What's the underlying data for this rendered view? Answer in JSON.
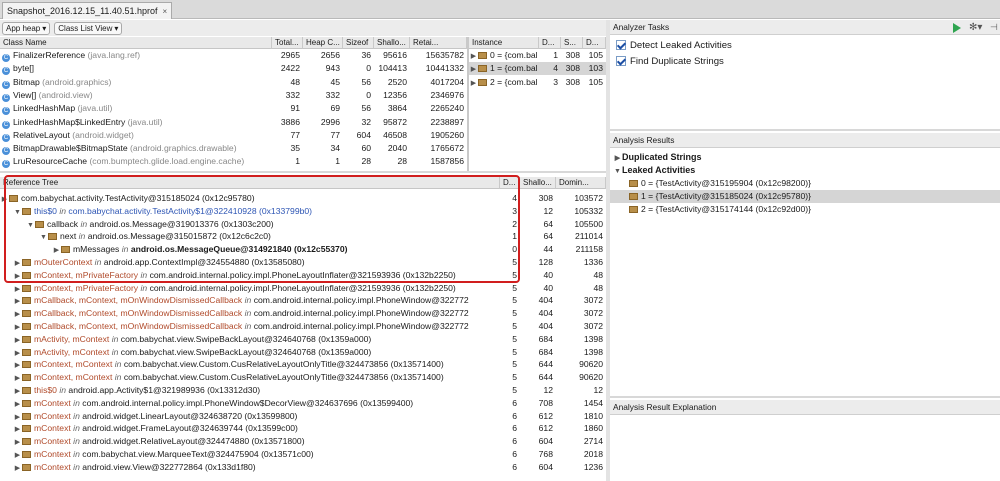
{
  "tab": {
    "title": "Snapshot_2016.12.15_11.40.51.hprof",
    "close": "×"
  },
  "toolbar": {
    "heap": "App heap",
    "view": "Class List View"
  },
  "class_table": {
    "headers": [
      "Class Name",
      "Total...",
      "Heap C...",
      "Sizeof",
      "Shallo...",
      "Retai..."
    ],
    "rows": [
      {
        "name": "FinalizerReference",
        "pkg": "(java.lang.ref)",
        "total": "2965",
        "heap": "2656",
        "sizeof": "36",
        "shallow": "95616",
        "retained": "15635782"
      },
      {
        "name": "byte[]",
        "pkg": "",
        "total": "2422",
        "heap": "943",
        "sizeof": "0",
        "shallow": "104413",
        "retained": "10441332"
      },
      {
        "name": "Bitmap",
        "pkg": "(android.graphics)",
        "total": "48",
        "heap": "45",
        "sizeof": "56",
        "shallow": "2520",
        "retained": "4017204"
      },
      {
        "name": "View[]",
        "pkg": "(android.view)",
        "total": "332",
        "heap": "332",
        "sizeof": "0",
        "shallow": "12356",
        "retained": "2346976"
      },
      {
        "name": "LinkedHashMap",
        "pkg": "(java.util)",
        "total": "91",
        "heap": "69",
        "sizeof": "56",
        "shallow": "3864",
        "retained": "2265240"
      },
      {
        "name": "LinkedHashMap$LinkedEntry",
        "pkg": "(java.util)",
        "total": "3886",
        "heap": "2996",
        "sizeof": "32",
        "shallow": "95872",
        "retained": "2238897"
      },
      {
        "name": "RelativeLayout",
        "pkg": "(android.widget)",
        "total": "77",
        "heap": "77",
        "sizeof": "604",
        "shallow": "46508",
        "retained": "1905260"
      },
      {
        "name": "BitmapDrawable$BitmapState",
        "pkg": "(android.graphics.drawable)",
        "total": "35",
        "heap": "34",
        "sizeof": "60",
        "shallow": "2040",
        "retained": "1765672"
      },
      {
        "name": "LruResourceCache",
        "pkg": "(com.bumptech.glide.load.engine.cache)",
        "total": "1",
        "heap": "1",
        "sizeof": "28",
        "shallow": "28",
        "retained": "1587856"
      }
    ]
  },
  "instance_table": {
    "headers": [
      "Instance",
      "D...",
      "S...",
      "D..."
    ],
    "rows": [
      {
        "label": "0 = {com.bal",
        "d": "1",
        "s": "308",
        "d2": "105"
      },
      {
        "label": "1 = {com.bal",
        "d": "4",
        "s": "308",
        "d2": "103"
      },
      {
        "label": "2 = {com.bal",
        "d": "3",
        "s": "308",
        "d2": "105"
      }
    ]
  },
  "reference_tree": {
    "headers": [
      "Reference Tree",
      "D...",
      "Shallo...",
      "Domin..."
    ],
    "rows": [
      {
        "text": "com.babychat.activity.TestActivity@315185024 (0x12c95780)",
        "d": "4",
        "shallow": "308",
        "dom": "103572"
      },
      {
        "field": "this$0",
        "text": "com.babychat.activity.TestActivity$1@322410928 (0x133799b0)",
        "d": "3",
        "shallow": "12",
        "dom": "105332"
      },
      {
        "field": "callback",
        "text": "android.os.Message@319013376 (0x1303c200)",
        "d": "2",
        "shallow": "64",
        "dom": "105500"
      },
      {
        "field": "next",
        "text": "android.os.Message@315015872 (0x12c6c2c0)",
        "d": "1",
        "shallow": "64",
        "dom": "211014"
      },
      {
        "field": "mMessages",
        "text": "android.os.MessageQueue@314921840 (0x12c55370)",
        "d": "0",
        "shallow": "44",
        "dom": "211158"
      },
      {
        "field": "mOuterContext",
        "text": "android.app.ContextImpl@324554880 (0x13585080)",
        "d": "5",
        "shallow": "128",
        "dom": "1336"
      },
      {
        "field": "mContext, mPrivateFactory",
        "text": "com.android.internal.policy.impl.PhoneLayoutInflater@321593936 (0x132b2250)",
        "d": "5",
        "shallow": "40",
        "dom": "48"
      },
      {
        "field": "mContext, mPrivateFactory",
        "text": "com.android.internal.policy.impl.PhoneLayoutInflater@321593936 (0x132b2250)",
        "d": "5",
        "shallow": "40",
        "dom": "48"
      },
      {
        "field": "mCallback, mContext, mOnWindowDismissedCallback",
        "text": "com.android.internal.policy.impl.PhoneWindow@322772",
        "d": "5",
        "shallow": "404",
        "dom": "3072"
      },
      {
        "field": "mCallback, mContext, mOnWindowDismissedCallback",
        "text": "com.android.internal.policy.impl.PhoneWindow@322772",
        "d": "5",
        "shallow": "404",
        "dom": "3072"
      },
      {
        "field": "mCallback, mContext, mOnWindowDismissedCallback",
        "text": "com.android.internal.policy.impl.PhoneWindow@322772",
        "d": "5",
        "shallow": "404",
        "dom": "3072"
      },
      {
        "field": "mActivity, mContext",
        "text": "com.babychat.view.SwipeBackLayout@324640768 (0x1359a000)",
        "d": "5",
        "shallow": "684",
        "dom": "1398"
      },
      {
        "field": "mActivity, mContext",
        "text": "com.babychat.view.SwipeBackLayout@324640768 (0x1359a000)",
        "d": "5",
        "shallow": "684",
        "dom": "1398"
      },
      {
        "field": "mContext, mContext",
        "text": "com.babychat.view.Custom.CusRelativeLayoutOnlyTitle@324473856 (0x13571400)",
        "d": "5",
        "shallow": "644",
        "dom": "90620"
      },
      {
        "field": "mContext, mContext",
        "text": "com.babychat.view.Custom.CusRelativeLayoutOnlyTitle@324473856 (0x13571400)",
        "d": "5",
        "shallow": "644",
        "dom": "90620"
      },
      {
        "field": "this$0",
        "text": "android.app.Activity$1@321989936 (0x13312d30)",
        "d": "5",
        "shallow": "12",
        "dom": "12"
      },
      {
        "field": "mContext",
        "text": "com.android.internal.policy.impl.PhoneWindow$DecorView@324637696 (0x13599400)",
        "d": "6",
        "shallow": "708",
        "dom": "1454"
      },
      {
        "field": "mContext",
        "text": "android.widget.LinearLayout@324638720 (0x13599800)",
        "d": "6",
        "shallow": "612",
        "dom": "1810"
      },
      {
        "field": "mContext",
        "text": "android.widget.FrameLayout@324639744 (0x13599c00)",
        "d": "6",
        "shallow": "612",
        "dom": "1860"
      },
      {
        "field": "mContext",
        "text": "android.widget.RelativeLayout@324474880 (0x13571800)",
        "d": "6",
        "shallow": "604",
        "dom": "2714"
      },
      {
        "field": "mContext",
        "text": "com.babychat.view.MarqueeText@324475904 (0x13571c00)",
        "d": "6",
        "shallow": "768",
        "dom": "2018"
      },
      {
        "field": "mContext",
        "text": "android.view.View@322772864 (0x133d1f80)",
        "d": "6",
        "shallow": "604",
        "dom": "1236"
      }
    ]
  },
  "analyzer": {
    "tasks_title": "Analyzer Tasks",
    "tasks": [
      "Detect Leaked Activities",
      "Find Duplicate Strings"
    ],
    "results_title": "Analysis Results",
    "dup_label": "Duplicated Strings",
    "leak_label": "Leaked Activities",
    "leaks": [
      "0 = {TestActivity@315195904 (0x12c98200)}",
      "1 = {TestActivity@315185024 (0x12c95780)}",
      "2 = {TestActivity@315174144 (0x12c92d00)}"
    ],
    "explanation_title": "Analysis Result Explanation"
  },
  "icons": {
    "run": "run-icon",
    "settings": "gear-icon",
    "hide": "hide-icon"
  },
  "colors": {
    "highlight": "#d11e1e",
    "run": "#2ea44f",
    "selection": "#d5d5d5"
  }
}
